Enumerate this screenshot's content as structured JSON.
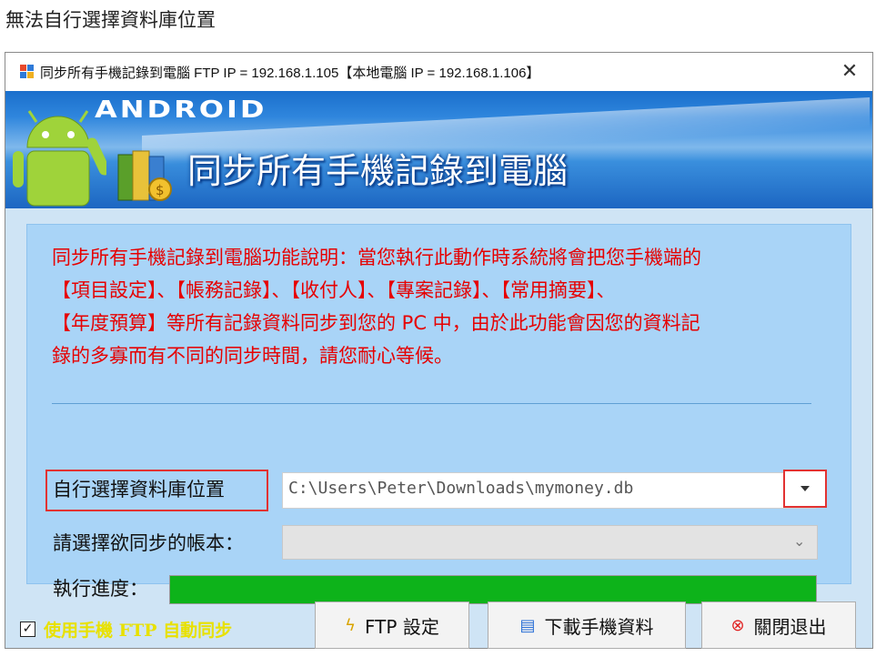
{
  "caption": "無法自行選擇資料庫位置",
  "window": {
    "title": "同步所有手機記錄到電腦 FTP IP = 192.168.1.105【本地電腦 IP = 192.168.1.106】",
    "close_label": "✕"
  },
  "banner": {
    "android_word": "ANDROID",
    "title": "同步所有手機記錄到電腦"
  },
  "description": {
    "lines": [
      "同步所有手機記錄到電腦功能說明：當您執行此動作時系統將會把您手機端的",
      "【項目設定】、【帳務記錄】、【收付人】、【專案記錄】、【常用摘要】、",
      "【年度預算】等所有記錄資料同步到您的 PC 中，由於此功能會因您的資料記",
      "錄的多寡而有不同的同步時間，請您耐心等候。"
    ]
  },
  "db_location": {
    "label": "自行選擇資料庫位置",
    "value": "C:\\Users\\Peter\\Downloads\\mymoney.db"
  },
  "account_book": {
    "label": "請選擇欲同步的帳本：",
    "value": ""
  },
  "progress": {
    "label": "執行進度：",
    "value_percent": 100,
    "fill_color": "#0db31a"
  },
  "footer": {
    "auto_sync_checked": true,
    "auto_sync_label": "使用手機 FTP 自動同步",
    "ftp_button": "FTP 設定",
    "download_button": "下載手機資料",
    "close_button": "關閉退出"
  },
  "colors": {
    "description_text": "#e60000",
    "highlight_box": "#e23232",
    "auto_sync_label": "#e8e100",
    "panel_bg": "#a9d4f7"
  },
  "icons": {
    "app": "app-icon",
    "ftp": "lightning-icon",
    "download": "list-icon",
    "close": "close-circle-icon"
  }
}
